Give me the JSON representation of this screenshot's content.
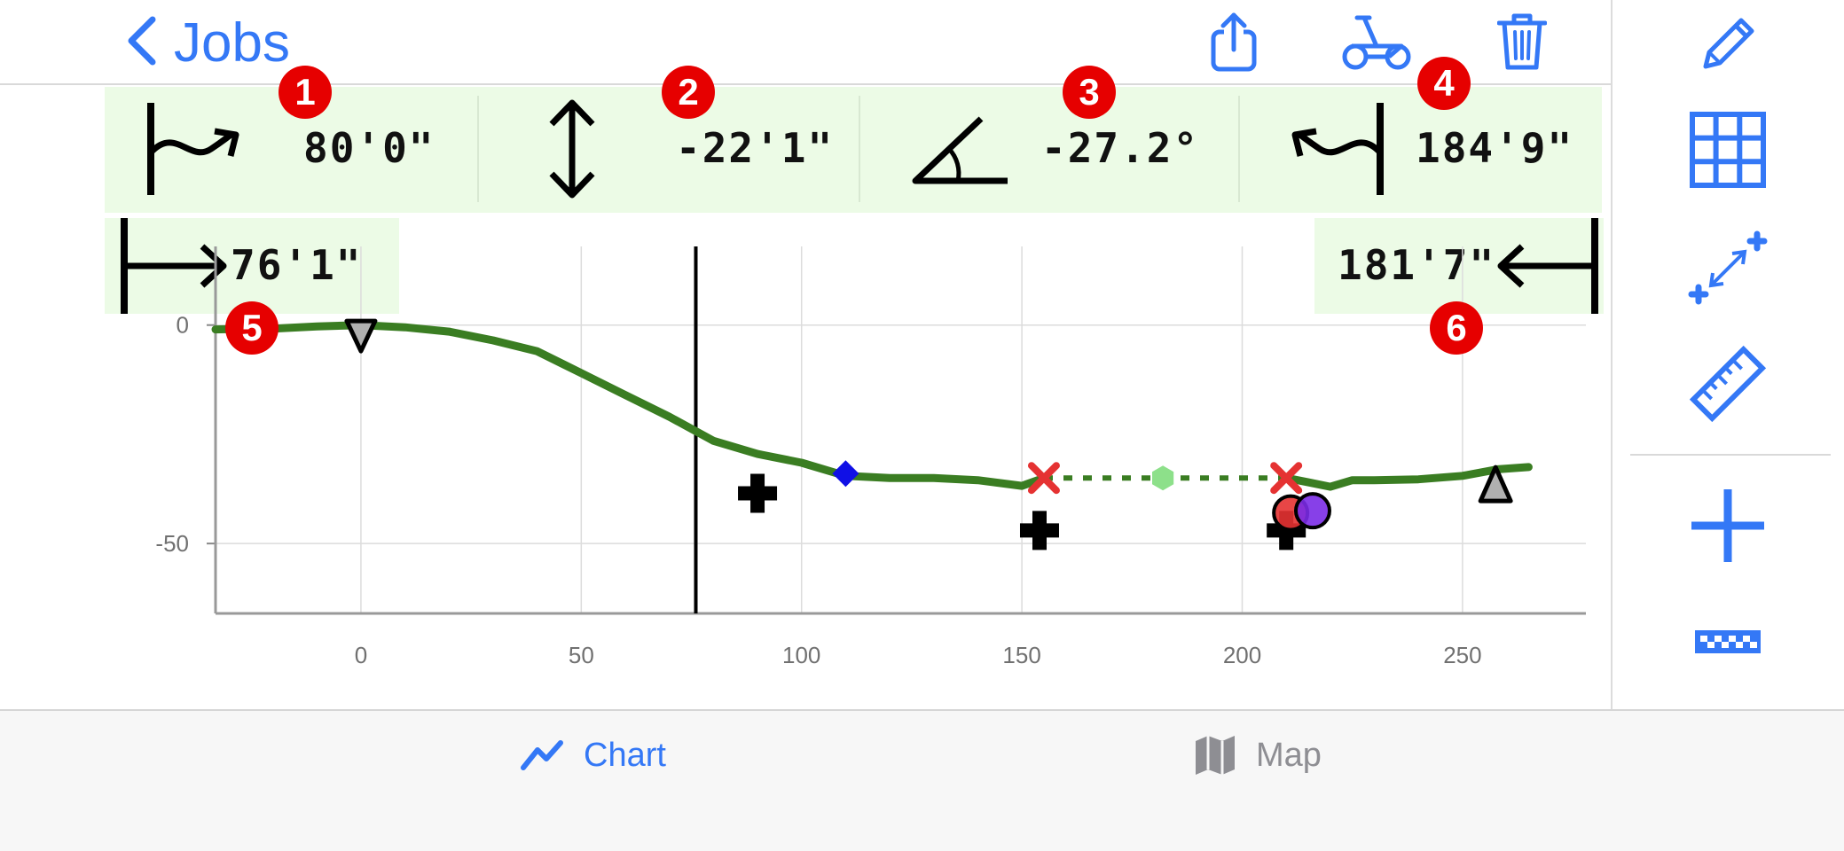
{
  "nav": {
    "back_label": "Jobs"
  },
  "header_icons": [
    "share-icon",
    "cart-icon",
    "trash-icon"
  ],
  "sidebar_icons": [
    "pencil-icon",
    "grid-icon",
    "stretch-icon",
    "ruler-icon",
    "plus-icon",
    "checker-icon"
  ],
  "measurements": {
    "m1": {
      "badge": "1",
      "value": "80'0\""
    },
    "m2": {
      "badge": "2",
      "value": "-22'1\""
    },
    "m3": {
      "badge": "3",
      "value": "-27.2°"
    },
    "m4": {
      "badge": "4",
      "value": "184'9\""
    },
    "m5": {
      "badge": "5",
      "value": "76'1\""
    },
    "m6": {
      "badge": "6",
      "value": "181'7\""
    }
  },
  "chart_data": {
    "type": "line",
    "x_ticks": [
      "0",
      "50",
      "100",
      "150",
      "200",
      "250"
    ],
    "y_ticks": [
      "0",
      "-50"
    ],
    "xlim": [
      -33,
      278
    ],
    "ylim": [
      -66,
      18
    ],
    "cursor_x": 76,
    "series": [
      {
        "style": "solid",
        "color": "#3a7d22",
        "x": [
          -33,
          -20,
          -10,
          0,
          10,
          20,
          30,
          40,
          50,
          60,
          70,
          80,
          90,
          100,
          110,
          120,
          130,
          140,
          150,
          155
        ],
        "y": [
          -1,
          -0.8,
          -0.3,
          0,
          -0.5,
          -1.5,
          -3.5,
          -6,
          -11,
          -16,
          -21,
          -26.5,
          -29.5,
          -31.5,
          -34.5,
          -35,
          -35,
          -35.5,
          -36.8,
          -35
        ]
      },
      {
        "style": "dashed",
        "color": "#3a7d22",
        "x": [
          155,
          182,
          210
        ],
        "y": [
          -35,
          -35,
          -35
        ]
      },
      {
        "style": "solid",
        "color": "#3a7d22",
        "x": [
          210,
          215,
          220,
          225,
          230,
          240,
          250,
          258,
          265
        ],
        "y": [
          -35,
          -36,
          -37,
          -35.5,
          -35.5,
          -35.3,
          -34.5,
          -33,
          -32.5
        ]
      }
    ],
    "markers": [
      {
        "type": "triangle-down",
        "x": 0,
        "y": -1.5,
        "color": "#b0b0b0"
      },
      {
        "type": "triangle-up",
        "x": 257.5,
        "y": -36,
        "color": "#b0b0b0"
      },
      {
        "type": "diamond",
        "x": 110,
        "y": -34,
        "color": "#1010e6"
      },
      {
        "type": "x",
        "x": 155,
        "y": -35,
        "color": "#e53232"
      },
      {
        "type": "x",
        "x": 210,
        "y": -35,
        "color": "#e53232"
      },
      {
        "type": "hexagon",
        "x": 182,
        "y": -35,
        "color": "#8de08a"
      },
      {
        "type": "plus",
        "x": 90,
        "y": -38.5,
        "color": "#000000"
      },
      {
        "type": "plus",
        "x": 154,
        "y": -47,
        "color": "#000000"
      },
      {
        "type": "plus",
        "x": 210,
        "y": -47,
        "color": "#000000"
      },
      {
        "type": "circle",
        "x": 211,
        "y": -43,
        "color": "#e53232"
      },
      {
        "type": "circle",
        "x": 216,
        "y": -42.5,
        "color": "#7a2be6"
      }
    ]
  },
  "tabs": [
    {
      "label": "Chart",
      "active": true
    },
    {
      "label": "Map",
      "active": false
    }
  ],
  "colors": {
    "accent": "#3478f6",
    "badge": "#e60000",
    "info_bg": "#ecfbe6",
    "line": "#3a7d22",
    "inactive_tab": "#8e8e93"
  }
}
